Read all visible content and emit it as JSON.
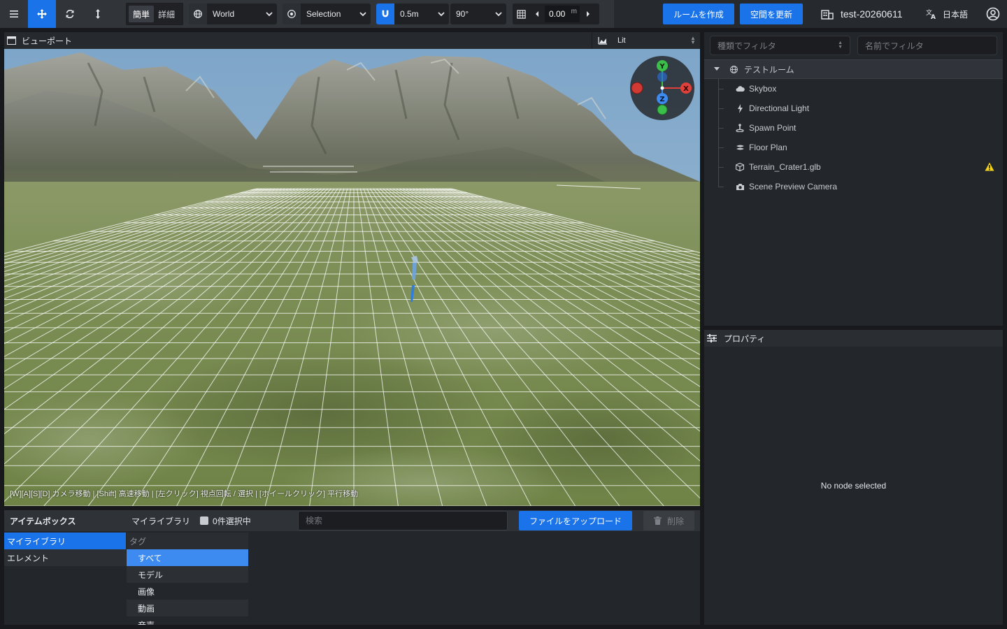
{
  "toolbar": {
    "mode_simple": "簡単",
    "mode_detail": "詳細",
    "space": "World",
    "pivot": "Selection",
    "snap_move": "0.5m",
    "snap_rotate": "90°",
    "grid_value": "0.00",
    "grid_unit": "m",
    "create_room": "ルームを作成",
    "update_space": "空間を更新",
    "project_name": "test-20260611",
    "language": "日本語",
    "accent": "#1a73e8"
  },
  "viewport": {
    "title": "ビューポート",
    "shading": "Lit",
    "hint": "[W][A][S][D] カメラ移動 | [Shift] 高速移動 | [左クリック] 視点回転 / 選択 | [ホイールクリック] 平行移動",
    "gizmo": {
      "y": "Y",
      "x": "X",
      "z": "Z"
    }
  },
  "itembox": {
    "title": "アイテムボックス",
    "library_label": "マイライブラリ",
    "selected_count": "0件選択中",
    "search_placeholder": "検索",
    "upload": "ファイルをアップロード",
    "delete": "削除",
    "categories": [
      "マイライブラリ",
      "エレメント"
    ],
    "tag_header": "タグ",
    "tags": [
      "すべて",
      "モデル",
      "画像",
      "動画",
      "音声"
    ]
  },
  "outliner": {
    "filter_type_placeholder": "種類でフィルタ",
    "filter_name_placeholder": "名前でフィルタ",
    "root": "テストルーム",
    "nodes": [
      {
        "label": "Skybox",
        "icon": "cloud-icon"
      },
      {
        "label": "Directional Light",
        "icon": "bolt-icon"
      },
      {
        "label": "Spawn Point",
        "icon": "spawn-icon"
      },
      {
        "label": "Floor Plan",
        "icon": "layers-icon"
      },
      {
        "label": "Terrain_Crater1.glb",
        "icon": "cube-icon",
        "warning": true
      },
      {
        "label": "Scene Preview Camera",
        "icon": "camera-icon"
      }
    ]
  },
  "properties": {
    "title": "プロパティ",
    "empty": "No node selected"
  }
}
